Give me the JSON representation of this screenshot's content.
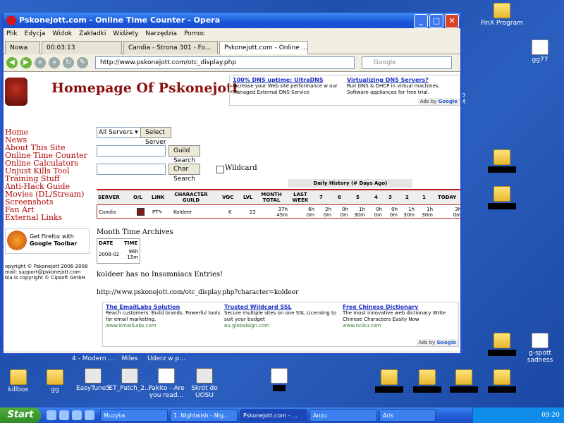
{
  "desktop": {
    "icons_right": [
      "FinX Program",
      "gg77",
      "g-spott sadness"
    ],
    "icons_bottom": [
      "killbox",
      "gg",
      "EasyTune5",
      "ET_Patch_2...",
      "Pakito - Are you read...",
      "Skrót do UOSU"
    ],
    "partial_labels": [
      "4 - Modern ...",
      "Miles",
      "Uderz w p...",
      "it do",
      "CAM"
    ]
  },
  "window": {
    "title": "Pskonejott.com - Online Time Counter - Opera",
    "menu": [
      "Plik",
      "Edycja",
      "Widok",
      "Zakładki",
      "Widżety",
      "Narzędzia",
      "Pomoc"
    ],
    "tabs": [
      {
        "label": "Nowa"
      },
      {
        "label": "00:03:13"
      },
      {
        "label": "Candia - Strona 301 - Fo..."
      },
      {
        "label": "Pskonejott.com - Online ..."
      }
    ],
    "address": "http://www.pskonejott.com/otc_display.php",
    "search_placeholder": "Google"
  },
  "page": {
    "site_title": "Homepage Of Pskonejott",
    "ad_top": {
      "items": [
        {
          "head": "100% DNS uptime: UltraDNS",
          "text": "Increase your Web site performance w our Managed External DNS Service"
        },
        {
          "head": "Virtualizing DNS Servers?",
          "text": "Run DNS & DHCP in virtual machines. Software appliances for free trial."
        }
      ],
      "adsby": "Ads by",
      "google": "Google"
    },
    "sidebar": [
      "Home",
      "News",
      "About This Site",
      "Online Time Counter",
      "Online Calculators",
      "Unjust Kills Tool",
      "Training Stuff",
      "Anti-Hack Guide",
      "Movies (DL/Stream)",
      "Screenshots",
      "Fan Art",
      "External Links"
    ],
    "firefox": {
      "line1": "Get Firefox with",
      "line2": "Google Toolbar"
    },
    "copyright": [
      "opyright © Pskonejott 2006-2008",
      "mail: support@pskonejott.com",
      "bia is copyright © Cipsoft GmbH"
    ],
    "server_select": "All Servers",
    "select_server_btn": "Select Server",
    "guild_search_btn": "Guild Search",
    "char_search_btn": "Char Search",
    "wildcard_label": "Wildcard",
    "daily_history": "Daily History (# Days Ago)",
    "table_headers": [
      "SERVER",
      "O/L",
      "LINK",
      "CHARACTER GUILD",
      "VOC",
      "LVL",
      "MONTH TOTAL",
      "LAST WEEK",
      "7",
      "6",
      "5",
      "4",
      "3",
      "2",
      "1",
      "TODAY"
    ],
    "table_row": [
      "Candia",
      "",
      "PT",
      "Koldeer",
      "K",
      "22",
      "37h 45m",
      "6h 0m",
      "2h 0m",
      "0h 0m",
      "1h 30m",
      "0h 0m",
      "0h 0m",
      "1h 30m",
      "1h 30m",
      "3h 0m"
    ],
    "archives_title": "Month Time Archives",
    "archives_headers": [
      "DATE",
      "TIME"
    ],
    "archives_row": [
      "2008-02",
      "96h 15m"
    ],
    "no_entries": "koldeer has no Insomniacs Entries!",
    "url_text": "http://www.pskonejott.com/otc_display.php?character=koldeer",
    "ad_bottom": {
      "items": [
        {
          "head": "The EmailLabs Solution",
          "text": "Reach customers. Build brands. Powerful tools for email marketing.",
          "url": "www.EmailLabs.com"
        },
        {
          "head": "Trusted Wildcard SSL",
          "text": "Secure multiple sites on one SSL Licensing to suit your budget",
          "url": "eu.globalsign.com"
        },
        {
          "head": "Free Chinese Dictionary",
          "text": "The most innovative web dictionary Write Chinese Characters Easily Now",
          "url": "www.nciku.com"
        }
      ],
      "adsby": "Ads by",
      "google": "Google"
    }
  },
  "taskbar": {
    "start": "Start",
    "tasks": [
      "Muzyka",
      "1. Nightwish - Nig...",
      "Pskonejott.com - ...",
      "Anzu",
      "Aris"
    ],
    "clock": "09:20"
  }
}
